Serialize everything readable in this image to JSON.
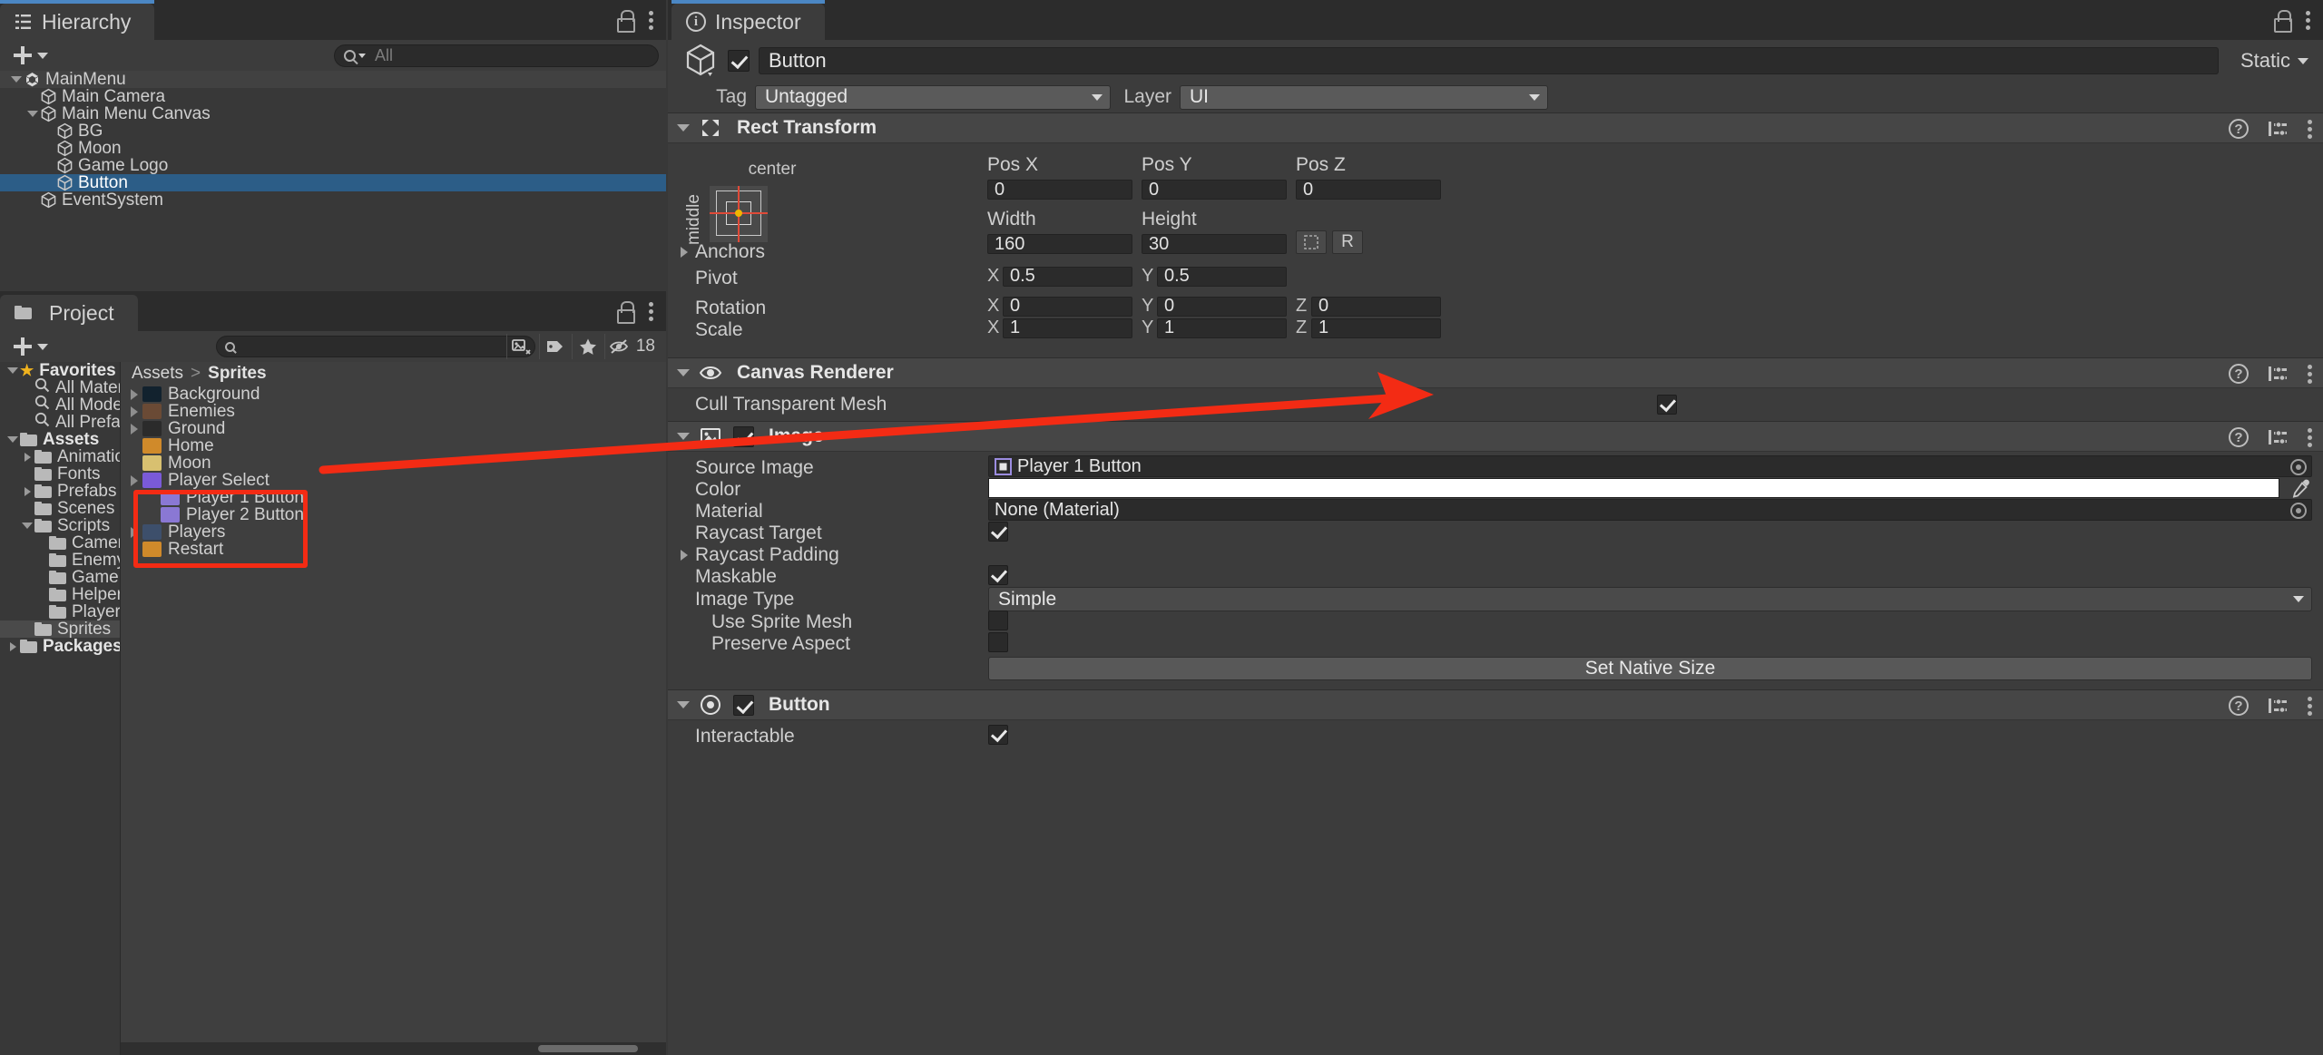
{
  "app": "Unity Editor",
  "hierarchy": {
    "tab_label": "Hierarchy",
    "search_placeholder": "All",
    "add_label": "+",
    "items": [
      {
        "label": "MainMenu",
        "depth": 0,
        "icon": "unity-scene-icon",
        "expanded": true,
        "selected": false,
        "is_scene": true
      },
      {
        "label": "Main Camera",
        "depth": 1,
        "icon": "gameobject-cube-icon",
        "expanded": null,
        "selected": false,
        "is_scene": false
      },
      {
        "label": "Main Menu Canvas",
        "depth": 1,
        "icon": "gameobject-cube-icon",
        "expanded": true,
        "selected": false,
        "is_scene": false
      },
      {
        "label": "BG",
        "depth": 2,
        "icon": "gameobject-cube-icon",
        "expanded": null,
        "selected": false,
        "is_scene": false
      },
      {
        "label": "Moon",
        "depth": 2,
        "icon": "gameobject-cube-icon",
        "expanded": null,
        "selected": false,
        "is_scene": false
      },
      {
        "label": "Game Logo",
        "depth": 2,
        "icon": "gameobject-cube-icon",
        "expanded": null,
        "selected": false,
        "is_scene": false
      },
      {
        "label": "Button",
        "depth": 2,
        "icon": "gameobject-cube-icon",
        "expanded": null,
        "selected": true,
        "is_scene": false
      },
      {
        "label": "EventSystem",
        "depth": 1,
        "icon": "gameobject-cube-icon",
        "expanded": null,
        "selected": false,
        "is_scene": false
      }
    ]
  },
  "project": {
    "tab_label": "Project",
    "add_label": "+",
    "search_value": "",
    "visible_count": "18",
    "breadcrumb": {
      "root": "Assets",
      "separator": ">",
      "current": "Sprites"
    },
    "tree": [
      {
        "label": "Favorites",
        "depth": 0,
        "icon": "star-icon",
        "expanded": true,
        "bold": true
      },
      {
        "label": "All Materials",
        "depth": 1,
        "icon": "search-icon",
        "expanded": null,
        "bold": false
      },
      {
        "label": "All Models",
        "depth": 1,
        "icon": "search-icon",
        "expanded": null,
        "bold": false
      },
      {
        "label": "All Prefabs",
        "depth": 1,
        "icon": "search-icon",
        "expanded": null,
        "bold": false
      },
      {
        "label": "Assets",
        "depth": 0,
        "icon": "folder-icon",
        "expanded": true,
        "bold": true
      },
      {
        "label": "Animations",
        "depth": 1,
        "icon": "folder-icon",
        "expanded": false,
        "bold": false
      },
      {
        "label": "Fonts",
        "depth": 1,
        "icon": "folder-icon",
        "expanded": null,
        "bold": false
      },
      {
        "label": "Prefabs",
        "depth": 1,
        "icon": "folder-icon",
        "expanded": false,
        "bold": false
      },
      {
        "label": "Scenes",
        "depth": 1,
        "icon": "folder-icon",
        "expanded": null,
        "bold": false
      },
      {
        "label": "Scripts",
        "depth": 1,
        "icon": "folder-icon",
        "expanded": true,
        "bold": false
      },
      {
        "label": "Camera S",
        "depth": 2,
        "icon": "folder-icon",
        "expanded": null,
        "bold": false
      },
      {
        "label": "Enemy Sc",
        "depth": 2,
        "icon": "folder-icon",
        "expanded": null,
        "bold": false
      },
      {
        "label": "Gameplay",
        "depth": 2,
        "icon": "folder-icon",
        "expanded": null,
        "bold": false
      },
      {
        "label": "Helper Sc",
        "depth": 2,
        "icon": "folder-icon",
        "expanded": null,
        "bold": false
      },
      {
        "label": "Player Sc",
        "depth": 2,
        "icon": "folder-icon",
        "expanded": null,
        "bold": false
      },
      {
        "label": "Sprites",
        "depth": 1,
        "icon": "folder-icon",
        "expanded": null,
        "bold": false,
        "selected": true
      },
      {
        "label": "Packages",
        "depth": 0,
        "icon": "folder-icon",
        "expanded": false,
        "bold": true
      }
    ],
    "assets": [
      {
        "label": "Background",
        "expandable": true,
        "thumb": "#12222e",
        "depth": 0
      },
      {
        "label": "Enemies",
        "expandable": true,
        "thumb": "#6a4a35",
        "depth": 0
      },
      {
        "label": "Ground",
        "expandable": true,
        "thumb": "#2b2b2b",
        "depth": 0
      },
      {
        "label": "Home",
        "expandable": false,
        "thumb": "#d08a2a",
        "depth": 0
      },
      {
        "label": "Moon",
        "expandable": false,
        "thumb": "#d8c070",
        "depth": 0
      },
      {
        "label": "Player Select",
        "expandable": true,
        "thumb": "#7a5ad8",
        "depth": 0,
        "highlighted": true
      },
      {
        "label": "Player 1 Button",
        "expandable": false,
        "thumb": "#8a78d4",
        "depth": 1,
        "highlighted": true
      },
      {
        "label": "Player 2 Button",
        "expandable": false,
        "thumb": "#8a78d4",
        "depth": 1,
        "highlighted": true
      },
      {
        "label": "Players",
        "expandable": true,
        "thumb": "#3d4f6b",
        "depth": 0,
        "highlighted": true
      },
      {
        "label": "Restart",
        "expandable": false,
        "thumb": "#d08a2a",
        "depth": 0
      }
    ]
  },
  "inspector": {
    "tab_label": "Inspector",
    "gameobject": {
      "enabled": true,
      "name": "Button",
      "static_label": "Static",
      "tag_label": "Tag",
      "tag_value": "Untagged",
      "layer_label": "Layer",
      "layer_value": "UI"
    },
    "components": [
      {
        "name": "Rect Transform",
        "icon": "rect-transform-icon",
        "expanded": true,
        "has_checkbox": false,
        "anchor_preset": {
          "horizontal": "center",
          "vertical": "middle"
        },
        "fields": {
          "pos_x_label": "Pos X",
          "pos_x": "0",
          "pos_y_label": "Pos Y",
          "pos_y": "0",
          "pos_z_label": "Pos Z",
          "pos_z": "0",
          "width_label": "Width",
          "width": "160",
          "height_label": "Height",
          "height": "30",
          "anchors_label": "Anchors",
          "pivot_label": "Pivot",
          "pivot_x": "0.5",
          "pivot_y": "0.5",
          "rotation_label": "Rotation",
          "rot_x": "0",
          "rot_y": "0",
          "rot_z": "0",
          "scale_label": "Scale",
          "scale_x": "1",
          "scale_y": "1",
          "scale_z": "1",
          "blueprint_label": "R"
        }
      },
      {
        "name": "Canvas Renderer",
        "icon": "eye-icon",
        "expanded": true,
        "has_checkbox": false,
        "rows": [
          {
            "label": "Cull Transparent Mesh",
            "type": "checkbox",
            "value": true
          }
        ]
      },
      {
        "name": "Image",
        "icon": "image-icon",
        "expanded": true,
        "has_checkbox": true,
        "checked": true,
        "rows": [
          {
            "label": "Source Image",
            "type": "object",
            "value": "Player 1 Button"
          },
          {
            "label": "Color",
            "type": "color",
            "value": "#ffffff"
          },
          {
            "label": "Material",
            "type": "object",
            "value": "None (Material)"
          },
          {
            "label": "Raycast Target",
            "type": "checkbox",
            "value": true
          },
          {
            "label": "Raycast Padding",
            "type": "foldout",
            "value": ""
          },
          {
            "label": "Maskable",
            "type": "checkbox",
            "value": true
          },
          {
            "label": "Image Type",
            "type": "dropdown",
            "value": "Simple"
          },
          {
            "label": "Use Sprite Mesh",
            "type": "checkbox",
            "value": false,
            "indent": true
          },
          {
            "label": "Preserve Aspect",
            "type": "checkbox",
            "value": false,
            "indent": true
          },
          {
            "label": "Set Native Size",
            "type": "button",
            "value": "Set Native Size"
          }
        ]
      },
      {
        "name": "Button",
        "icon": "button-icon",
        "expanded": true,
        "has_checkbox": true,
        "checked": true,
        "rows": [
          {
            "label": "Interactable",
            "type": "checkbox",
            "value": true
          }
        ]
      }
    ]
  },
  "annotations": {
    "arrow_color": "#f32b14",
    "box_color": "#f32b14",
    "arrow_target": "Source Image field",
    "box_target": "Player Select sprite folder"
  }
}
